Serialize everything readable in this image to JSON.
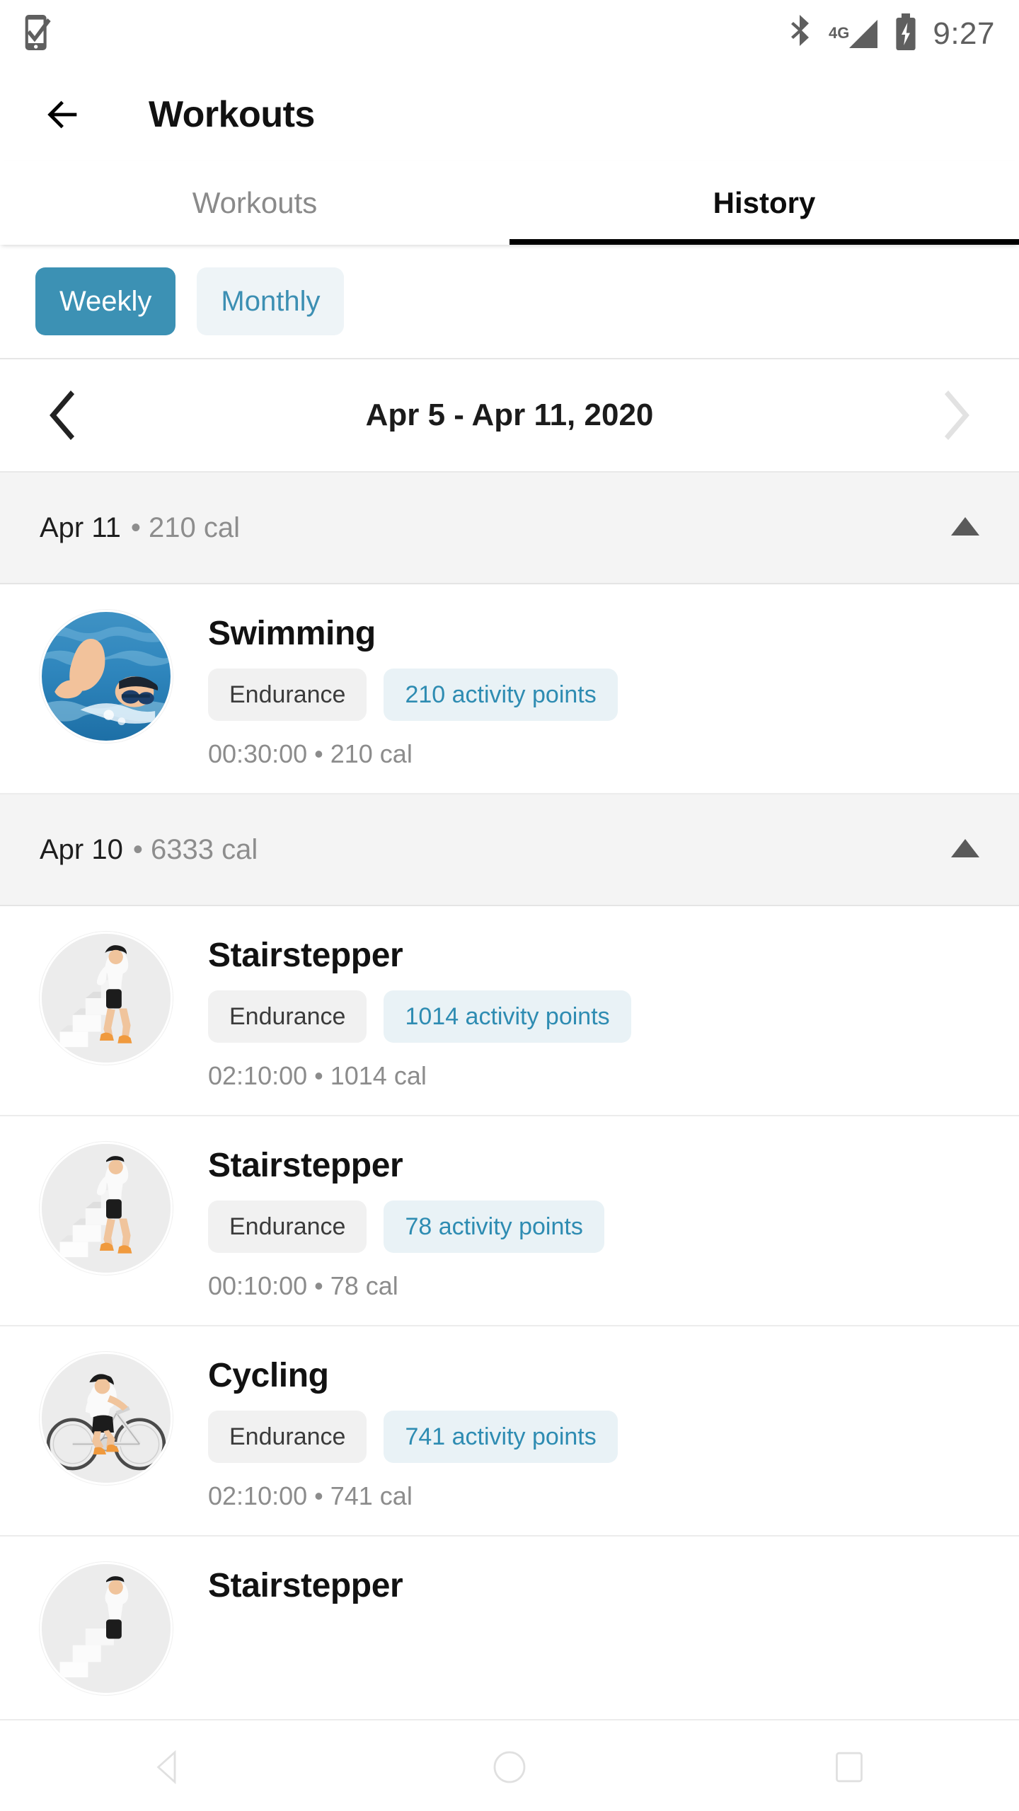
{
  "status_bar": {
    "left_icon": "phone-check-icon",
    "icons": [
      "bluetooth-icon",
      "signal-4g-icon",
      "battery-charging-icon"
    ],
    "network_label": "4G",
    "clock": "9:27"
  },
  "app_bar": {
    "back_icon": "back-arrow-icon",
    "title": "Workouts"
  },
  "tabs": [
    {
      "label": "Workouts",
      "active": false
    },
    {
      "label": "History",
      "active": true
    }
  ],
  "period_toggle": {
    "options": [
      {
        "label": "Weekly",
        "selected": true
      },
      {
        "label": "Monthly",
        "selected": false
      }
    ]
  },
  "date_nav": {
    "prev_icon": "chevron-left-icon",
    "next_icon": "chevron-right-icon",
    "range_label": "Apr 5 - Apr 11, 2020"
  },
  "groups": [
    {
      "date": "Apr 11",
      "separator": "•",
      "calories": "210 cal",
      "collapse_icon": "triangle-up-icon",
      "workouts": [
        {
          "thumb": "swimming-photo",
          "title": "Swimming",
          "category": "Endurance",
          "points": "210 activity points",
          "meta": "00:30:00 • 210 cal"
        }
      ]
    },
    {
      "date": "Apr 10",
      "separator": "•",
      "calories": "6333 cal",
      "collapse_icon": "triangle-up-icon",
      "workouts": [
        {
          "thumb": "stairstepper-photo",
          "title": "Stairstepper",
          "category": "Endurance",
          "points": "1014 activity points",
          "meta": "02:10:00 • 1014 cal"
        },
        {
          "thumb": "stairstepper-photo",
          "title": "Stairstepper",
          "category": "Endurance",
          "points": "78 activity points",
          "meta": "00:10:00 • 78 cal"
        },
        {
          "thumb": "cycling-photo",
          "title": "Cycling",
          "category": "Endurance",
          "points": "741 activity points",
          "meta": "02:10:00 • 741 cal"
        },
        {
          "thumb": "stairstepper-photo",
          "title": "Stairstepper",
          "category": "",
          "points": "",
          "meta": ""
        }
      ]
    }
  ],
  "nav_bar": {
    "back_icon": "nav-back-icon",
    "home_icon": "nav-home-icon",
    "recents_icon": "nav-recents-icon"
  },
  "colors": {
    "accent": "#3c91b4",
    "accent_text": "#2e8cb2",
    "chip_points_bg": "#e9f2f6",
    "chip_cat_bg": "#f1f1f1",
    "group_header_bg": "#f4f4f4",
    "muted_text": "#8c8c8c"
  }
}
